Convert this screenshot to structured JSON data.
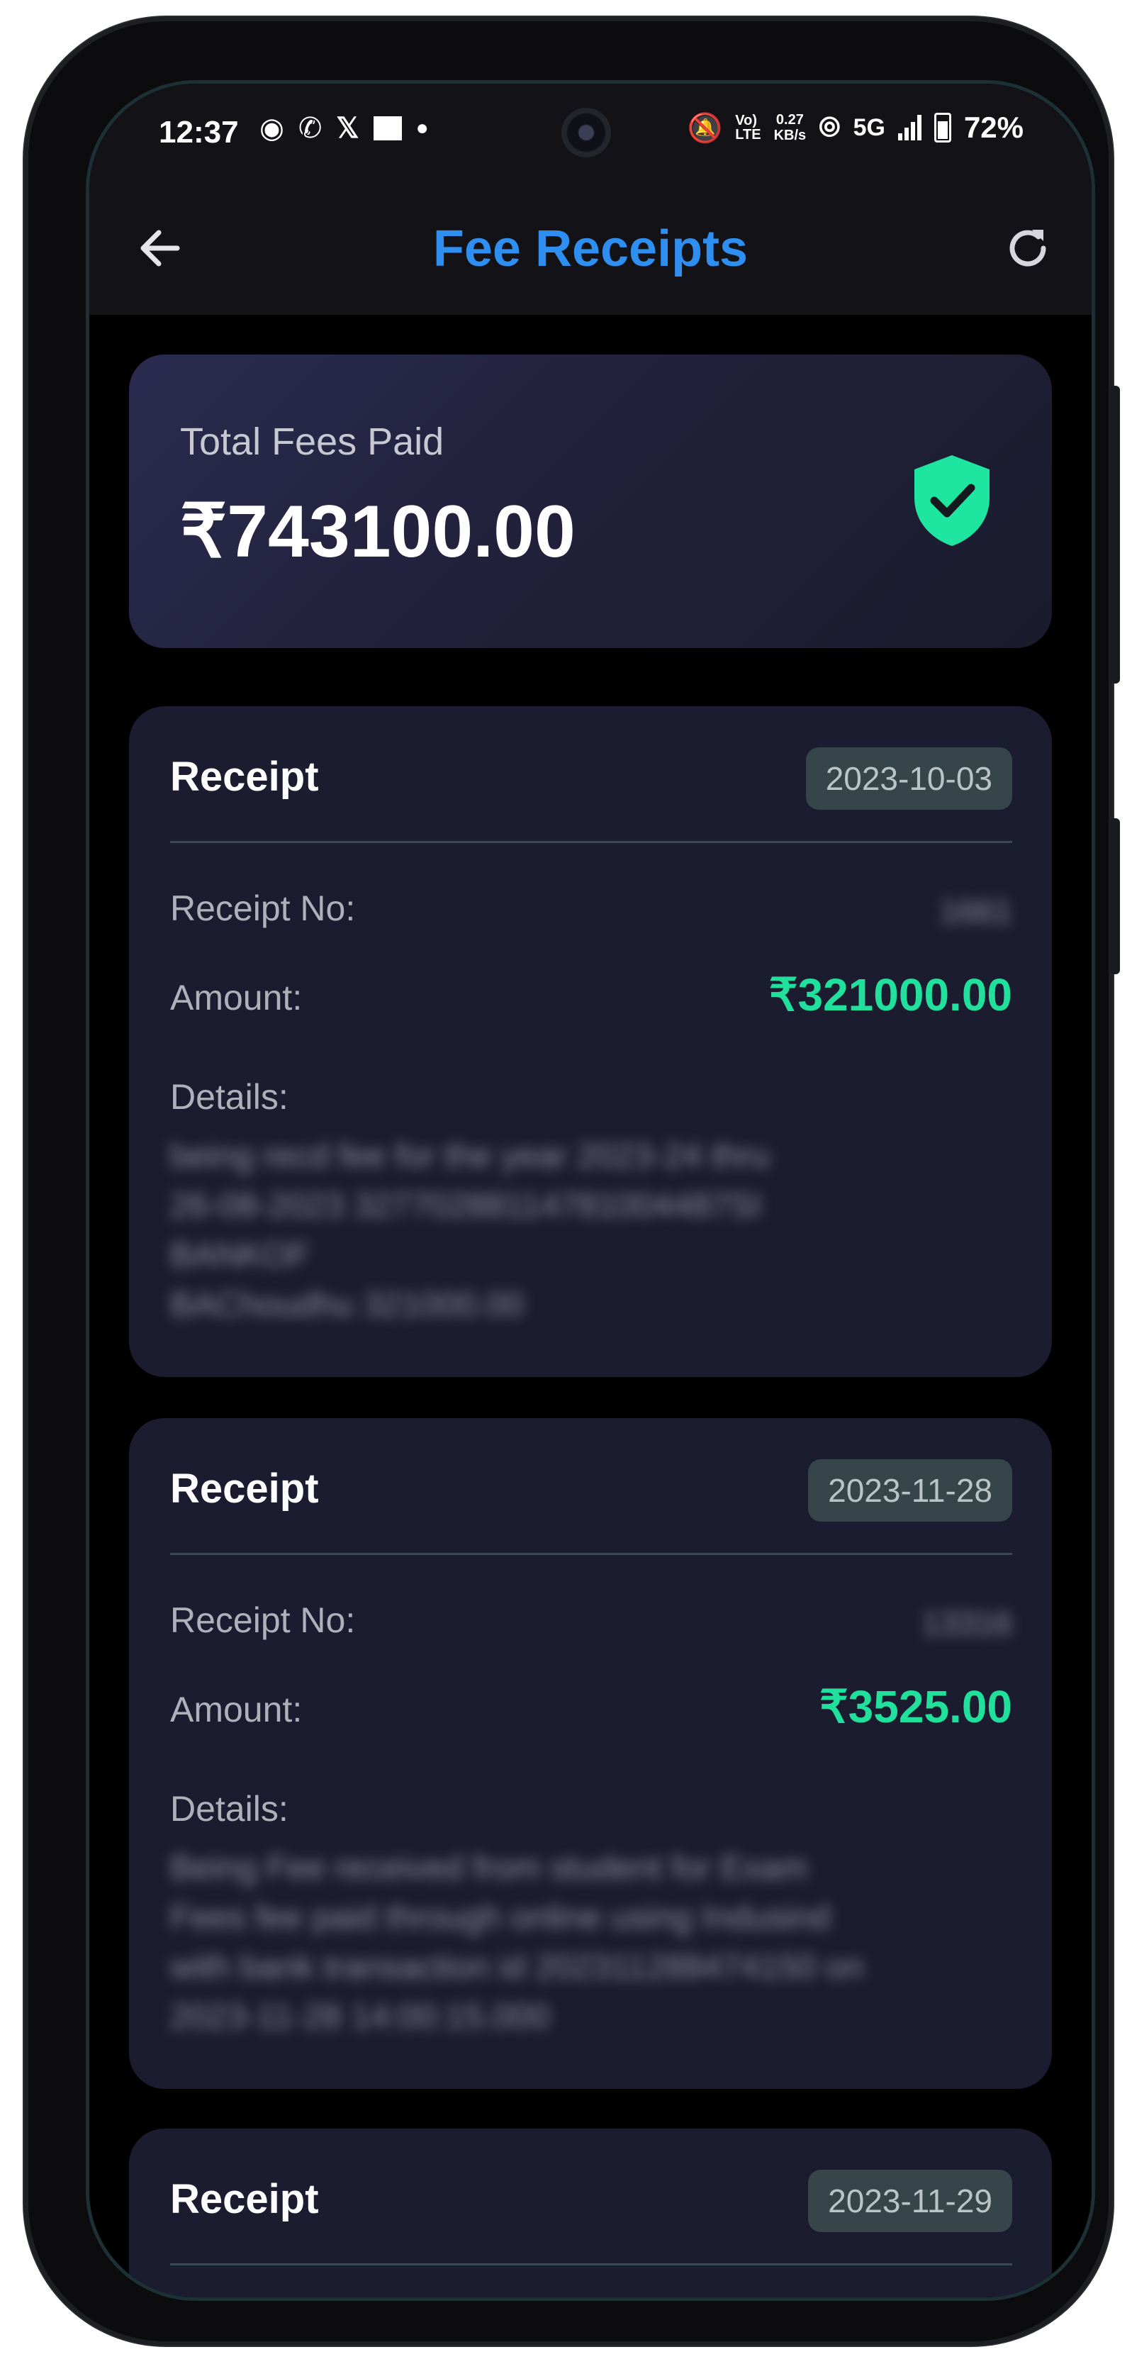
{
  "status_bar": {
    "time": "12:37",
    "net_speed_value": "0.27",
    "net_speed_unit": "KB/s",
    "volte_top": "Vo)",
    "volte_bottom": "LTE",
    "network": "5G",
    "battery": "72%"
  },
  "app_bar": {
    "title": "Fee Receipts",
    "back_icon": "arrow-left-icon",
    "refresh_icon": "refresh-icon"
  },
  "summary": {
    "label": "Total Fees Paid",
    "value": "₹743100.00",
    "icon": "shield-check-icon",
    "icon_color": "#1ee6a0"
  },
  "receipt_common": {
    "title": "Receipt",
    "receipt_no_label": "Receipt No:",
    "amount_label": "Amount:",
    "details_label": "Details:"
  },
  "receipts": [
    {
      "date": "2023-10-03",
      "receipt_no": "1661",
      "amount": "₹321000.00",
      "details": "being recd fee for the year 2023-24 thru\n26-08-2023   32770288114781004487SI\nBANKOF\nBAChoudhu    321000.00"
    },
    {
      "date": "2023-11-28",
      "receipt_no": "13316",
      "amount": "₹3525.00",
      "details": "Being Fee received from student for Exam\nFees fee paid through online using Indusind\nwith bank transaction id 202311288474150 on\n2023-11-28 14:00:15.000"
    },
    {
      "date": "2023-11-29"
    }
  ],
  "colors": {
    "accent": "#2e8ff0",
    "amount": "#21e09c",
    "card_bg": "#1c1c30",
    "app_bg": "#000000"
  }
}
